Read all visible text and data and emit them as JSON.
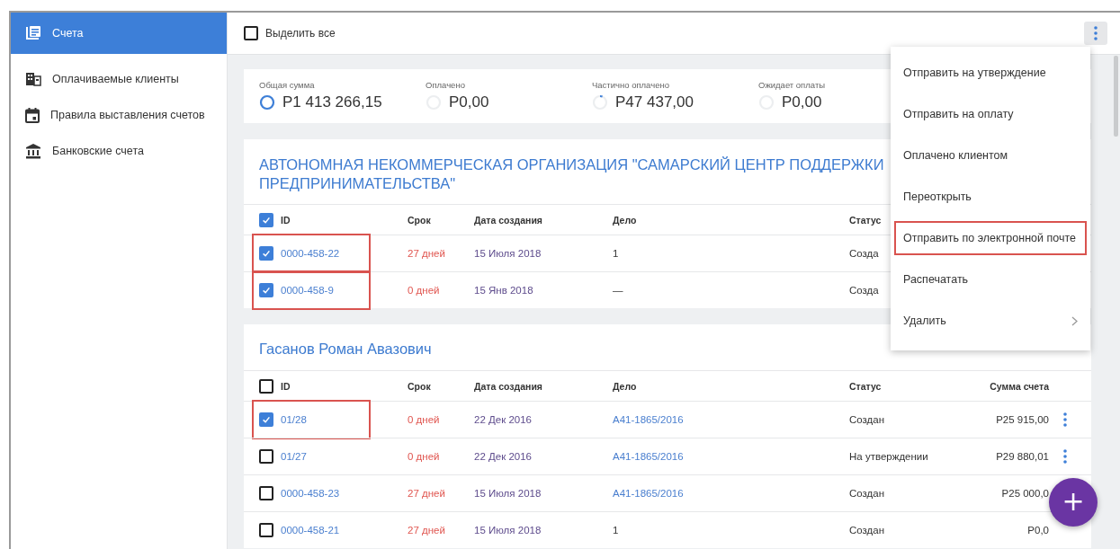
{
  "sidebar": {
    "items": [
      {
        "label": "Счета",
        "kind": "invoices",
        "selected": true
      },
      {
        "label": "Оплачиваемые клиенты",
        "kind": "clients",
        "selected": false
      },
      {
        "label": "Правила выставления счетов",
        "kind": "calendar",
        "selected": false
      },
      {
        "label": "Банковские счета",
        "kind": "bank",
        "selected": false
      }
    ]
  },
  "toolbar": {
    "select_all": {
      "label": "Выделить все",
      "checked": false
    },
    "menu_open": true
  },
  "summary": [
    {
      "label": "Общая сумма",
      "amount": "P1 413 266,15",
      "level": 1
    },
    {
      "label": "Оплачено",
      "amount": "P0,00",
      "level": 0
    },
    {
      "label": "Частично оплачено",
      "amount": "P47 437,00",
      "level": 0.06
    },
    {
      "label": "Ожидает оплаты",
      "amount": "P0,00",
      "level": 0
    }
  ],
  "groups": [
    {
      "title": "АВТОНОМНАЯ НЕКОММЕРЧЕСКАЯ ОРГАНИЗАЦИЯ \"САМАРСКИЙ ЦЕНТР ПОДДЕРЖКИ ПРЕДПРИНИМАТЕЛЬСТВА\"",
      "all_checked": true,
      "columns": [
        "ID",
        "Срок",
        "Дата создания",
        "Дело",
        "Статус"
      ],
      "rows": [
        {
          "id": "0000-458-22",
          "checked": true,
          "highlighted": true,
          "term": "27 дней",
          "date": "15 Июля 2018",
          "case": {
            "text": "1",
            "kind": "text"
          },
          "status": "Созда",
          "menu": false
        },
        {
          "id": "0000-458-9",
          "checked": true,
          "highlighted": true,
          "term": "0 дней",
          "date": "15 Янв 2018",
          "case": {
            "text": "—",
            "kind": "text"
          },
          "status": "Созда",
          "menu": false
        }
      ]
    },
    {
      "title": "Гасанов Роман Авазович",
      "all_checked": false,
      "columns": [
        "ID",
        "Срок",
        "Дата создания",
        "Дело",
        "Статус",
        "Сумма счета"
      ],
      "rows": [
        {
          "id": "01/28",
          "checked": true,
          "highlighted": true,
          "term": "0 дней",
          "date": "22 Дек 2016",
          "case": {
            "text": "A41-1865/2016",
            "kind": "link"
          },
          "status": "Создан",
          "amount": "P25 915,00",
          "menu": true
        },
        {
          "id": "01/27",
          "checked": false,
          "highlighted": false,
          "term": "0 дней",
          "date": "22 Дек 2016",
          "case": {
            "text": "A41-1865/2016",
            "kind": "link"
          },
          "status": "На утверждении",
          "amount": "P29 880,01",
          "menu": true
        },
        {
          "id": "0000-458-23",
          "checked": false,
          "highlighted": false,
          "term": "27 дней",
          "date": "15 Июля 2018",
          "case": {
            "text": "A41-1865/2016",
            "kind": "link"
          },
          "status": "Создан",
          "amount": "P25 000,0",
          "menu": false
        },
        {
          "id": "0000-458-21",
          "checked": false,
          "highlighted": false,
          "term": "27 дней",
          "date": "15 Июля 2018",
          "case": {
            "text": "1",
            "kind": "text"
          },
          "status": "Создан",
          "amount": "P0,0",
          "menu": false
        }
      ]
    }
  ],
  "context_menu": {
    "items": [
      {
        "label": "Отправить на утверждение",
        "highlighted": false,
        "submenu": false
      },
      {
        "label": "Отправить на оплату",
        "highlighted": false,
        "submenu": false
      },
      {
        "label": "Оплачено клиентом",
        "highlighted": false,
        "submenu": false
      },
      {
        "label": "Переоткрыть",
        "highlighted": false,
        "submenu": false
      },
      {
        "label": "Отправить по электронной почте",
        "highlighted": true,
        "submenu": false
      },
      {
        "label": "Распечатать",
        "highlighted": false,
        "submenu": false
      },
      {
        "label": "Удалить",
        "highlighted": false,
        "submenu": true
      }
    ]
  },
  "fab": {
    "label": "+"
  }
}
